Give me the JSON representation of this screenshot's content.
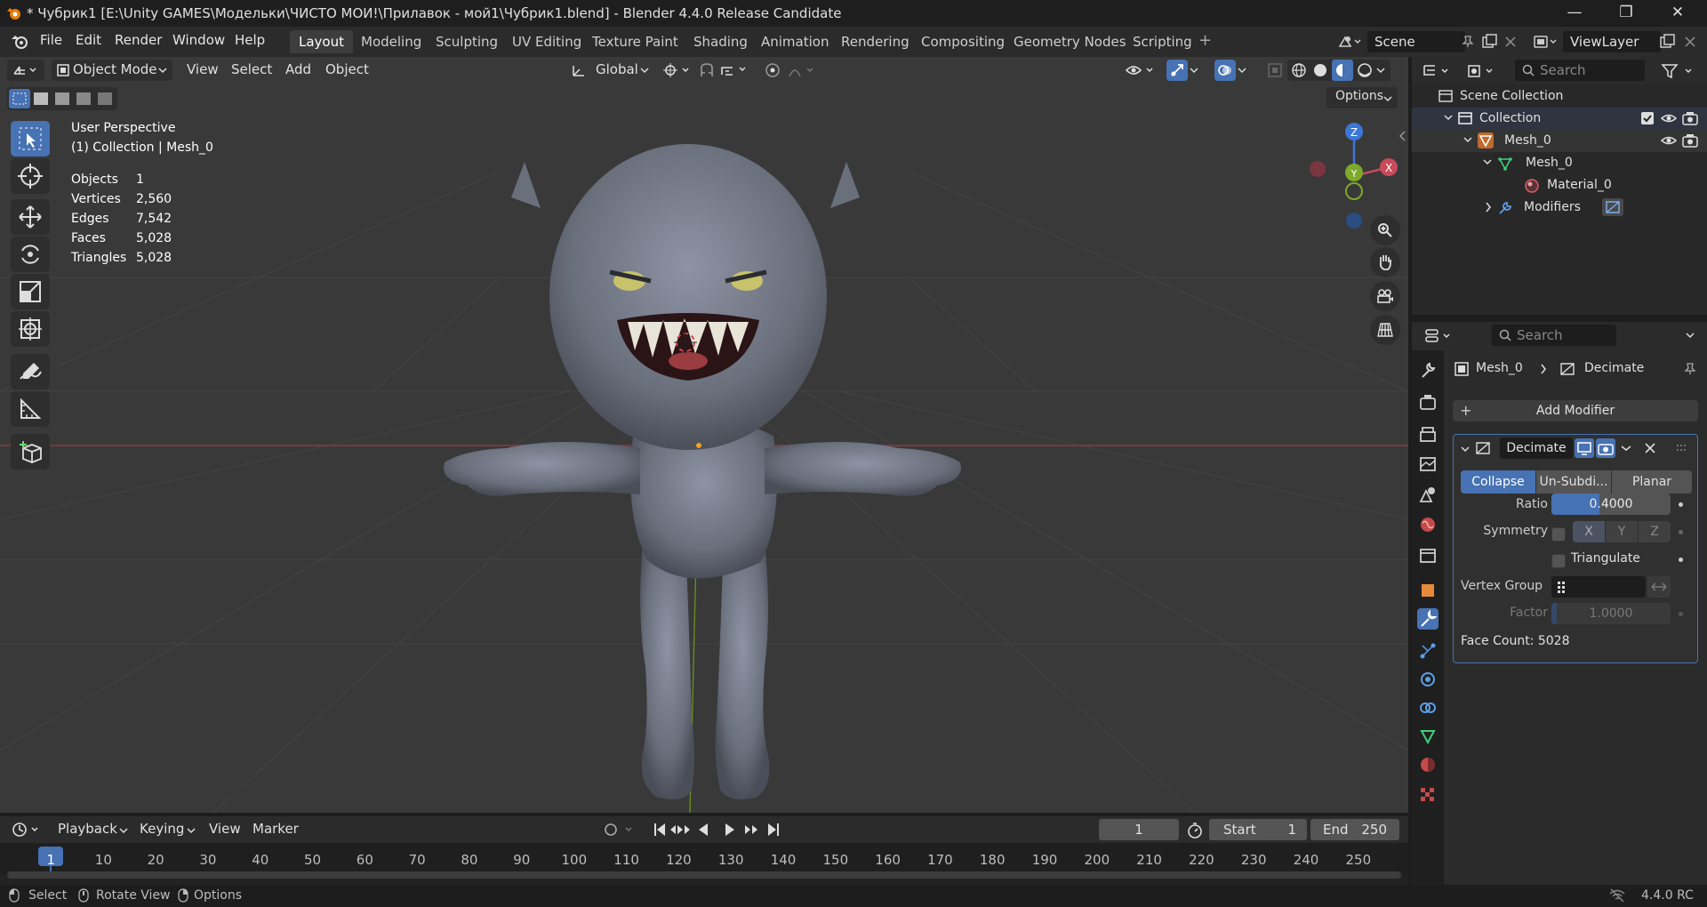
{
  "window": {
    "title": "* Чубрик1 [E:\\Unity GAMES\\Модельки\\ЧИСТО МОИ!\\Прилавок - мой1\\Чубрик1.blend] - Blender 4.4.0 Release Candidate",
    "minimize": "—",
    "maximize": "❐",
    "close": "✕"
  },
  "menu": [
    "File",
    "Edit",
    "Render",
    "Window",
    "Help"
  ],
  "workspaces": [
    "Layout",
    "Modeling",
    "Sculpting",
    "UV Editing",
    "Texture Paint",
    "Shading",
    "Animation",
    "Rendering",
    "Compositing",
    "Geometry Nodes",
    "Scripting"
  ],
  "active_workspace": "Layout",
  "add_workspace": "+",
  "scene": {
    "name": "Scene",
    "view_layer": "ViewLayer"
  },
  "viewport_header": {
    "mode": "Object Mode",
    "menus": [
      "View",
      "Select",
      "Add",
      "Object"
    ],
    "orientation": "Global",
    "options": "Options"
  },
  "overlay_text": {
    "perspective": "User Perspective",
    "collection": "(1) Collection | Mesh_0"
  },
  "stats": [
    {
      "label": "Objects",
      "value": "1"
    },
    {
      "label": "Vertices",
      "value": "2,560"
    },
    {
      "label": "Edges",
      "value": "7,542"
    },
    {
      "label": "Faces",
      "value": "5,028"
    },
    {
      "label": "Triangles",
      "value": "5,028"
    }
  ],
  "gizmo": {
    "z": "Z",
    "y": "Y",
    "x": "X"
  },
  "timeline": {
    "menus": [
      "Playback",
      "Keying",
      "View",
      "Marker"
    ],
    "current_frame": "1",
    "start_label": "Start",
    "start": "1",
    "end_label": "End",
    "end": "250",
    "ticks": [
      "1",
      "10",
      "20",
      "30",
      "40",
      "50",
      "60",
      "70",
      "80",
      "90",
      "100",
      "110",
      "120",
      "130",
      "140",
      "150",
      "160",
      "170",
      "180",
      "190",
      "200",
      "210",
      "220",
      "230",
      "240",
      "250"
    ]
  },
  "statusbar": {
    "select": "Select",
    "rotate": "Rotate View",
    "options": "Options",
    "version": "4.4.0 RC"
  },
  "outliner": {
    "search_placeholder": "Search",
    "rows": [
      {
        "label": "Scene Collection"
      },
      {
        "label": "Collection"
      },
      {
        "label": "Mesh_0"
      },
      {
        "label": "Mesh_0"
      },
      {
        "label": "Material_0"
      },
      {
        "label": "Modifiers"
      }
    ]
  },
  "properties": {
    "search_placeholder": "Search",
    "breadcrumb_object": "Mesh_0",
    "breadcrumb_modifier": "Decimate",
    "add_modifier": "Add Modifier",
    "modifier_name": "Decimate",
    "modes": [
      "Collapse",
      "Un-Subdi...",
      "Planar"
    ],
    "ratio_label": "Ratio",
    "ratio": "0.4000",
    "ratio_fraction": 0.4,
    "symmetry_label": "Symmetry",
    "axes": [
      "X",
      "Y",
      "Z"
    ],
    "triangulate_label": "Triangulate",
    "vertex_group_label": "Vertex Group",
    "factor_label": "Factor",
    "factor": "1.0000",
    "face_count": "Face Count: 5028"
  },
  "colors": {
    "accent": "#4772b3",
    "viewport": "#393939",
    "x_axis": "#c94a5a",
    "y_axis": "#7ea92a",
    "z_axis": "#3b77d6"
  }
}
